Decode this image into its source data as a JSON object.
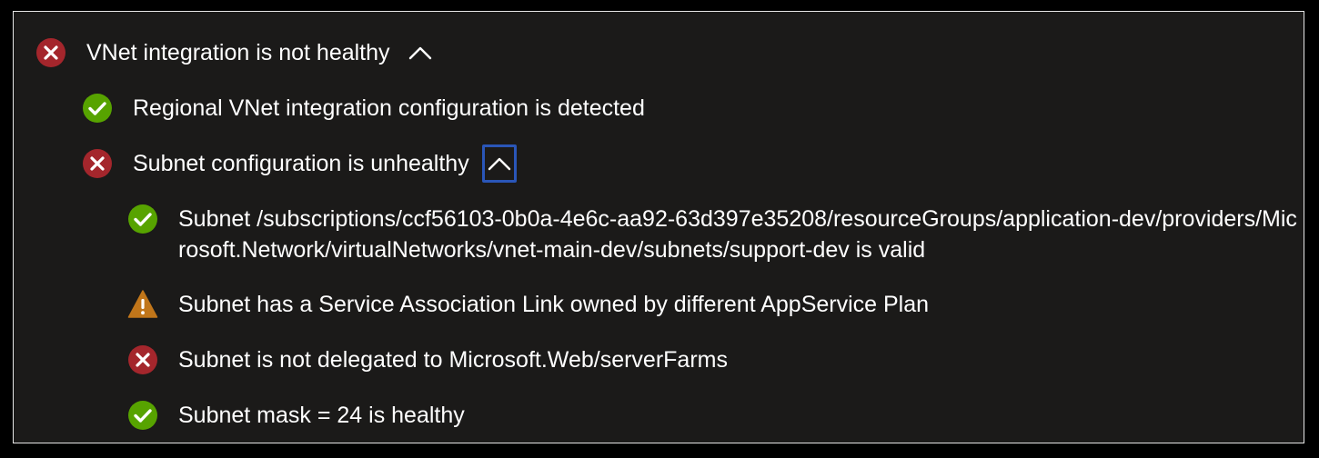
{
  "colors": {
    "error": "#a4262c",
    "success": "#57a300",
    "warning": "#c1761a",
    "background": "#1b1a19",
    "border": "#e6e6e6",
    "focus": "#2a56b8",
    "text": "#ffffff"
  },
  "tree": {
    "root": {
      "status": "error",
      "icon": "error-icon",
      "label": "VNet integration is not healthy",
      "expanded": true,
      "toggle_icon": "chevron-up-icon"
    },
    "regional": {
      "status": "success",
      "icon": "success-icon",
      "label": "Regional VNet integration configuration is detected"
    },
    "subnet": {
      "status": "error",
      "icon": "error-icon",
      "label": "Subnet configuration is unhealthy",
      "expanded": true,
      "toggle_icon": "chevron-up-icon"
    },
    "subnet_checks": [
      {
        "status": "success",
        "icon": "success-icon",
        "label": "Subnet /subscriptions/ccf56103-0b0a-4e6c-aa92-63d397e35208/resourceGroups/application-dev/providers/Microsoft.Network/virtualNetworks/vnet-main-dev/subnets/support-dev is valid"
      },
      {
        "status": "warning",
        "icon": "warning-icon",
        "label": "Subnet has a Service Association Link owned by different AppService Plan"
      },
      {
        "status": "error",
        "icon": "error-icon",
        "label": "Subnet is not delegated to Microsoft.Web/serverFarms"
      },
      {
        "status": "success",
        "icon": "success-icon",
        "label": "Subnet mask = 24 is healthy"
      }
    ]
  }
}
